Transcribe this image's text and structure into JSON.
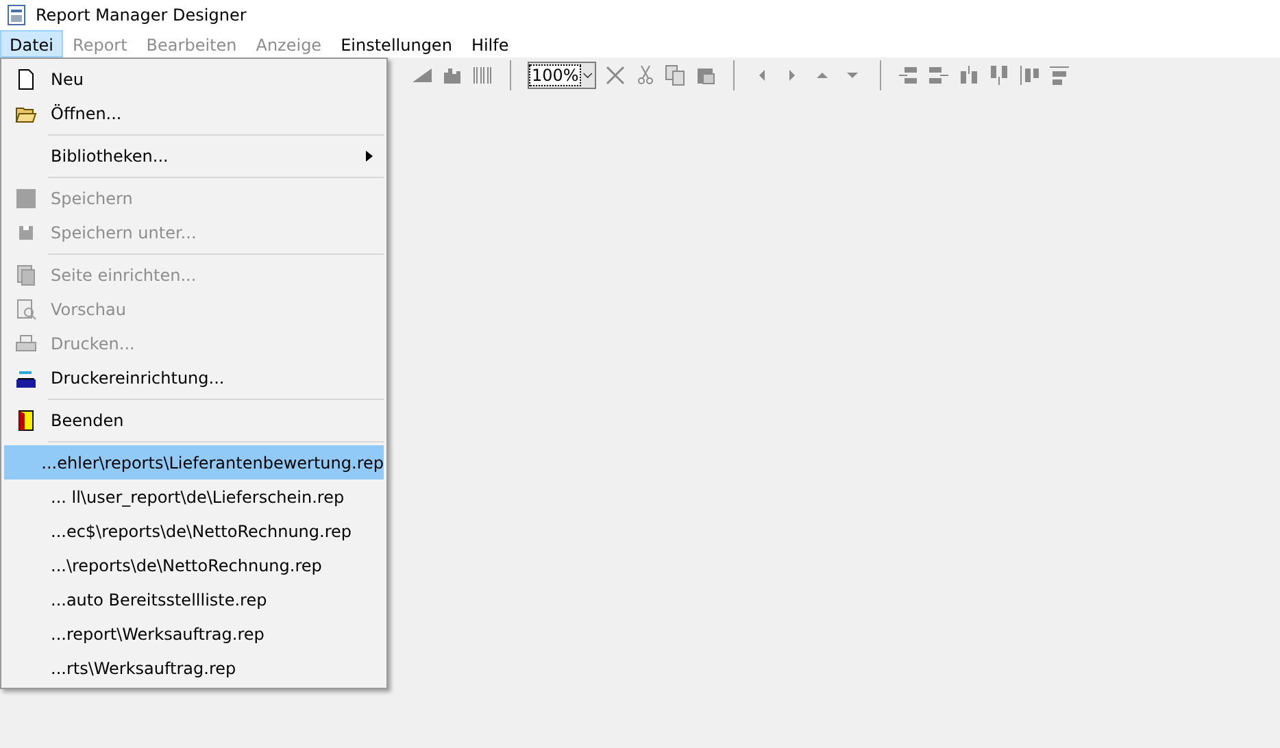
{
  "window": {
    "title": "Report Manager Designer"
  },
  "menu_bar": [
    {
      "label": "Datei",
      "selected": true,
      "disabled": false
    },
    {
      "label": "Report",
      "selected": false,
      "disabled": true
    },
    {
      "label": "Bearbeiten",
      "selected": false,
      "disabled": true
    },
    {
      "label": "Anzeige",
      "selected": false,
      "disabled": true
    },
    {
      "label": "Einstellungen",
      "selected": false,
      "disabled": false
    },
    {
      "label": "Hilfe",
      "selected": false,
      "disabled": false
    }
  ],
  "toolbar": {
    "zoom": "100%"
  },
  "file_menu": [
    {
      "kind": "item",
      "label": "Neu",
      "disabled": false
    },
    {
      "kind": "item",
      "label": "Öffnen...",
      "disabled": false
    },
    {
      "kind": "separator"
    },
    {
      "kind": "submenu",
      "label": "Bibliotheken...",
      "disabled": false
    },
    {
      "kind": "separator"
    },
    {
      "kind": "item",
      "label": "Speichern",
      "disabled": true
    },
    {
      "kind": "item",
      "label": "Speichern unter...",
      "disabled": true
    },
    {
      "kind": "separator"
    },
    {
      "kind": "item",
      "label": "Seite einrichten...",
      "disabled": true
    },
    {
      "kind": "item",
      "label": "Vorschau",
      "disabled": true
    },
    {
      "kind": "item",
      "label": "Drucken...",
      "disabled": true
    },
    {
      "kind": "item",
      "label": "Druckereinrichtung...",
      "disabled": false
    },
    {
      "kind": "separator"
    },
    {
      "kind": "item",
      "label": "Beenden",
      "disabled": false
    },
    {
      "kind": "separator"
    }
  ],
  "recent_files": [
    {
      "label": "...ehler\\reports\\Lieferantenbewertung.rep",
      "selected": true
    },
    {
      "label": "... ll\\user_report\\de\\Lieferschein.rep",
      "selected": false
    },
    {
      "label": "...ec$\\reports\\de\\NettoRechnung.rep",
      "selected": false
    },
    {
      "label": "...\\reports\\de\\NettoRechnung.rep",
      "selected": false
    },
    {
      "label": "...auto Bereitsstellliste.rep",
      "selected": false
    },
    {
      "label": "...report\\Werksauftrag.rep",
      "selected": false
    },
    {
      "label": "...rts\\Werksauftrag.rep",
      "selected": false
    }
  ]
}
